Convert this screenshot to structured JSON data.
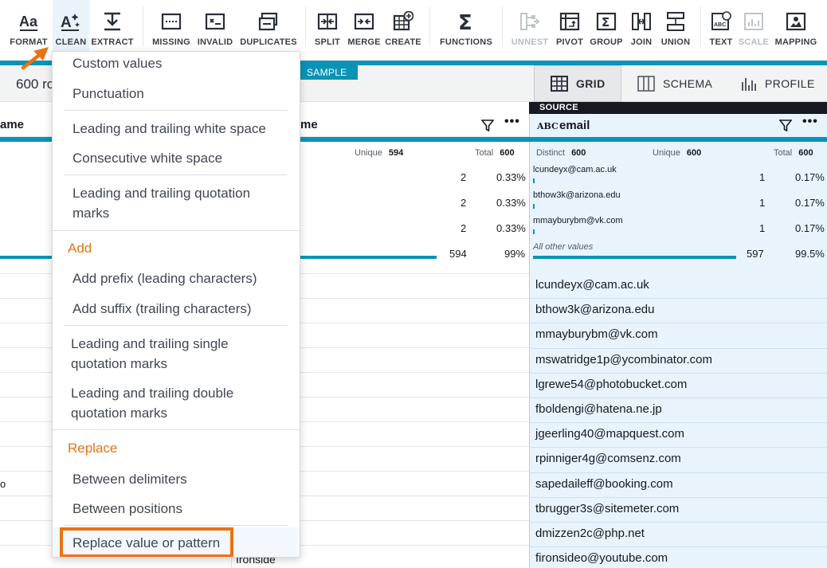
{
  "toolbar": {
    "items": [
      {
        "id": "format",
        "label": "FORMAT",
        "icon": "format-icon"
      },
      {
        "id": "clean",
        "label": "CLEAN",
        "icon": "clean-icon"
      },
      {
        "id": "extract",
        "label": "EXTRACT",
        "icon": "extract-icon"
      },
      {
        "id": "missing",
        "label": "MISSING",
        "icon": "missing-icon"
      },
      {
        "id": "invalid",
        "label": "INVALID",
        "icon": "invalid-icon"
      },
      {
        "id": "duplicates",
        "label": "DUPLICATES",
        "icon": "duplicates-icon"
      },
      {
        "id": "split",
        "label": "SPLIT",
        "icon": "split-icon"
      },
      {
        "id": "merge",
        "label": "MERGE",
        "icon": "merge-icon"
      },
      {
        "id": "create",
        "label": "CREATE",
        "icon": "create-icon"
      },
      {
        "id": "functions",
        "label": "FUNCTIONS",
        "icon": "sigma-icon"
      },
      {
        "id": "unnest",
        "label": "UNNEST",
        "icon": "unnest-icon"
      },
      {
        "id": "pivot",
        "label": "PIVOT",
        "icon": "pivot-icon"
      },
      {
        "id": "group",
        "label": "GROUP",
        "icon": "group-icon"
      },
      {
        "id": "join",
        "label": "JOIN",
        "icon": "join-icon"
      },
      {
        "id": "union",
        "label": "UNION",
        "icon": "union-icon"
      },
      {
        "id": "text",
        "label": "TEXT",
        "icon": "text-icon"
      },
      {
        "id": "scale",
        "label": "SCALE",
        "icon": "scale-icon"
      },
      {
        "id": "mapping",
        "label": "MAPPING",
        "icon": "mapping-icon"
      }
    ]
  },
  "info": {
    "row_count": "600 rc",
    "sample_tag": "SAMPLE"
  },
  "view_tabs": {
    "grid": "GRID",
    "schema": "SCHEMA",
    "profile": "PROFILE"
  },
  "columns": {
    "left_partial_name": "ame",
    "middle_name": "me",
    "middle_stats": {
      "unique_label": "Unique",
      "unique": "594",
      "total_label": "Total",
      "total": "600"
    },
    "middle_values": [
      {
        "count": "2",
        "pct": "0.33%"
      },
      {
        "count": "2",
        "pct": "0.33%"
      },
      {
        "count": "2",
        "pct": "0.33%"
      },
      {
        "count": "594",
        "pct": "99%"
      }
    ],
    "middle_last_cell": "Ironside",
    "left_partial_cell": "o",
    "source_label": "SOURCE",
    "email": {
      "type_label": "ABC",
      "name": "email",
      "stats": {
        "distinct_label": "Distinct",
        "distinct": "600",
        "unique_label": "Unique",
        "unique": "600",
        "total_label": "Total",
        "total": "600"
      },
      "top_values": [
        {
          "value": "lcundeyx@cam.ac.uk",
          "count": "1",
          "pct": "0.17%"
        },
        {
          "value": "bthow3k@arizona.edu",
          "count": "1",
          "pct": "0.17%"
        },
        {
          "value": "mmayburybm@vk.com",
          "count": "1",
          "pct": "0.17%"
        },
        {
          "value": "All other values",
          "count": "597",
          "pct": "99.5%"
        }
      ],
      "rows": [
        "lcundeyx@cam.ac.uk",
        "bthow3k@arizona.edu",
        "mmayburybm@vk.com",
        "mswatridge1p@ycombinator.com",
        "lgrewe54@photobucket.com",
        "fboldengi@hatena.ne.jp",
        "jgeerling40@mapquest.com",
        "rpinniger4g@comsenz.com",
        "sapedaileff@booking.com",
        "tbrugger3s@sitemeter.com",
        "dmizzen2c@php.net",
        "fironsideo@youtube.com"
      ]
    }
  },
  "menu": {
    "items": [
      "Custom values",
      "Punctuation",
      "Leading and trailing white space",
      "Consecutive white space",
      "Leading and trailing quotation",
      "marks",
      "Add prefix (leading characters)",
      "Add suffix (trailing characters)",
      "Leading and trailing single",
      "quotation marks",
      "Leading and trailing double",
      "quotation marks",
      "Between delimiters",
      "Between positions",
      "Replace value or pattern"
    ],
    "headers": {
      "add": "Add",
      "replace": "Replace"
    }
  },
  "colors": {
    "accent": "#0a93b6",
    "highlight": "#ec7211",
    "source_bg": "#e8f3fc"
  }
}
